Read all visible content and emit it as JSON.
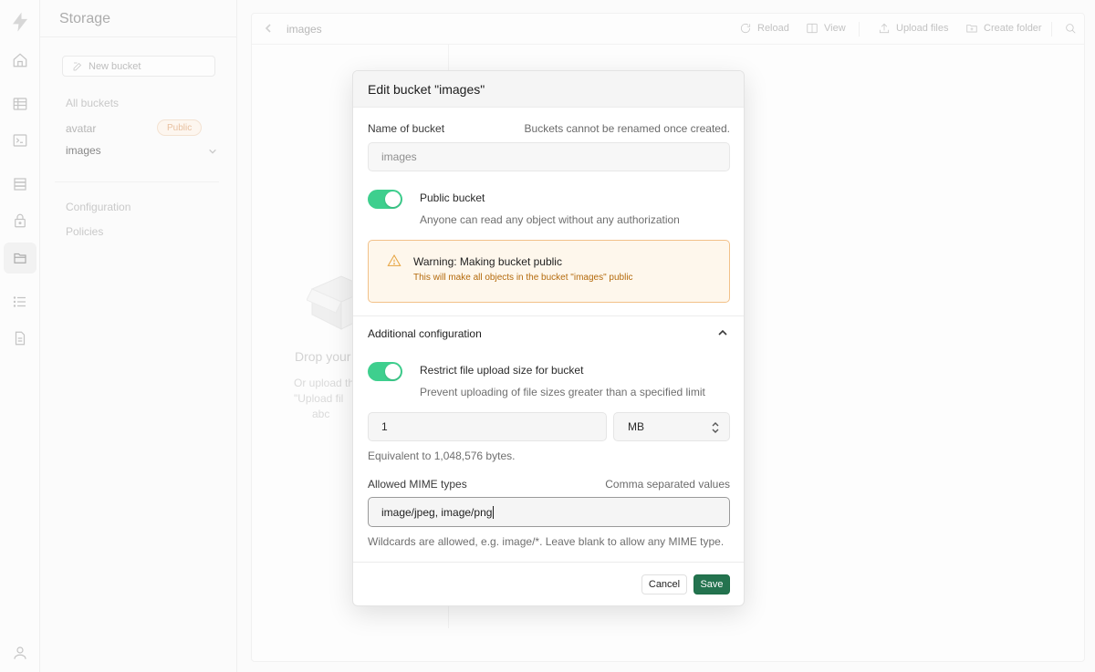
{
  "sidebar": {
    "title": "Storage",
    "new_bucket_label": "New bucket",
    "all_buckets_label": "All buckets",
    "buckets": [
      {
        "name": "avatar",
        "badge": "Public"
      },
      {
        "name": "images",
        "badge": ""
      }
    ],
    "configuration_label": "Configuration",
    "policies_label": "Policies"
  },
  "rail_icons": [
    "logo-icon",
    "home-icon",
    "table-editor-icon",
    "sql-editor-icon",
    "database-icon",
    "auth-icon",
    "storage-icon",
    "logs-icon",
    "docs-icon",
    "profile-icon"
  ],
  "main": {
    "breadcrumb": "images",
    "toolbar": {
      "reload_label": "Reload",
      "view_label": "View",
      "upload_label": "Upload files",
      "create_folder_label": "Create folder"
    },
    "drop": {
      "title": "Drop your",
      "line1": "Or upload th",
      "line2": "\"Upload fil",
      "line3": "abc"
    }
  },
  "modal": {
    "title": "Edit bucket \"images\"",
    "name_label": "Name of bucket",
    "name_hint": "Buckets cannot be renamed once created.",
    "name_value": "images",
    "public_toggle": {
      "on": true,
      "title": "Public bucket",
      "description": "Anyone can read any object without any authorization"
    },
    "warning": {
      "title": "Warning: Making bucket public",
      "text": "This will make all objects in the bucket \"images\" public"
    },
    "additional_title": "Additional configuration",
    "restrict_toggle": {
      "on": true,
      "title": "Restrict file upload size for bucket",
      "description": "Prevent uploading of file sizes greater than a specified limit"
    },
    "size_value": "1",
    "size_unit": "MB",
    "size_equivalent": "Equivalent to 1,048,576 bytes.",
    "mime_label": "Allowed MIME types",
    "mime_hint": "Comma separated values",
    "mime_value": "image/jpeg, image/png",
    "mime_help": "Wildcards are allowed, e.g. image/*. Leave blank to allow any MIME type.",
    "cancel_label": "Cancel",
    "save_label": "Save"
  },
  "colors": {
    "brand_green": "#3ecf8e",
    "save_button": "#24734f",
    "warning_bg": "#fef7ec",
    "warning_border": "#f2c189",
    "warning_text": "#b46a0c"
  }
}
